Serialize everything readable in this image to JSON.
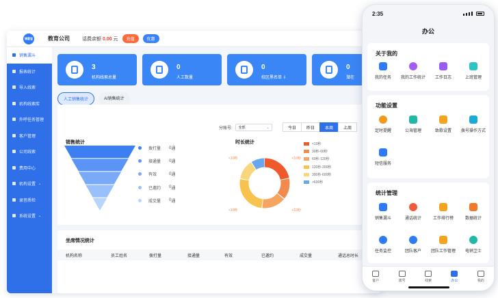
{
  "desktop": {
    "company": "教育公司",
    "balance_label": "话费余额",
    "balance_value": "0.00",
    "balance_unit": "元",
    "recharge": "充值",
    "discount": "优惠",
    "logo_text": "销客宝",
    "sidebar": [
      {
        "label": "销售漏斗",
        "active": true
      },
      {
        "label": "报表统计"
      },
      {
        "label": "导入线索"
      },
      {
        "label": "机构线索库"
      },
      {
        "label": "外呼任务管理"
      },
      {
        "label": "客户管理"
      },
      {
        "label": "公司线索"
      },
      {
        "label": "费用中心"
      },
      {
        "label": "机构设置",
        "arrow": "⌄"
      },
      {
        "label": "录音质检"
      },
      {
        "label": "系统设置",
        "arrow": "⌄"
      }
    ],
    "stats": [
      {
        "value": "3",
        "label": "机构线索总量"
      },
      {
        "value": "0",
        "label": "人工数量"
      },
      {
        "value": "0",
        "label": "校区黑名单 ⇩"
      },
      {
        "value": "0",
        "label": "潜在"
      }
    ],
    "tabs": [
      "人工销售统计",
      "AI销售统计"
    ],
    "filter_label": "分账号:",
    "filter_value": "全部",
    "range_buttons": [
      "今日",
      "昨日",
      "本周",
      "上周"
    ],
    "range_active": 2,
    "sales_title": "销售统计",
    "duration_title": "时长统计",
    "table_title": "坐席情况统计",
    "table_headers": [
      "机构名称",
      "员工姓名",
      "拨打量",
      "接通量",
      "有效",
      "已邀约",
      "成交量",
      "通话总时长"
    ]
  },
  "chart_data": [
    {
      "type": "funnel",
      "title": "销售统计",
      "categories": [
        "拨打量",
        "接通量",
        "有效",
        "已邀约",
        "成交量"
      ],
      "values": [
        0,
        0,
        0,
        0,
        0
      ],
      "value_unit": "通",
      "colors": [
        "#3b7ff2",
        "#5a95f5",
        "#78aaf7",
        "#98c0fa",
        "#b8d4fc"
      ]
    },
    {
      "type": "pie",
      "title": "时长统计",
      "categories": [
        "<10秒",
        "30秒-60秒",
        "60秒-120秒",
        "120秒-200秒",
        "300秒-600秒",
        ">600秒"
      ],
      "values": [
        22,
        14,
        16,
        26,
        13,
        9
      ],
      "colors": [
        "#ee5a2c",
        "#f08a4d",
        "#f6a561",
        "#f7c24d",
        "#f9d67c",
        "#6aa5f0"
      ],
      "outer_labels": [
        "<10秒",
        "<10秒",
        "<10秒",
        "<10秒"
      ]
    }
  ],
  "phone": {
    "time": "2:35",
    "title": "办公",
    "sections": [
      {
        "title": "关于我的",
        "items": [
          {
            "label": "我的任务",
            "color": "#2f7bf5"
          },
          {
            "label": "我的工作统计",
            "color": "#a35df5"
          },
          {
            "label": "工作日志",
            "color": "#9a5cf0"
          },
          {
            "label": "上班管理",
            "color": "#2ec4c7"
          }
        ]
      },
      {
        "title": "功能设置",
        "items": [
          {
            "label": "定时提醒",
            "color": "#f29a1c"
          },
          {
            "label": "公海管理",
            "color": "#21b8a6"
          },
          {
            "label": "致歌设置",
            "color": "#f2a51c"
          },
          {
            "label": "拨号操作方式",
            "color": "#1aa9d9"
          },
          {
            "label": "短信服务",
            "color": "#2f7bf5"
          }
        ]
      },
      {
        "title": "统计管理",
        "items": [
          {
            "label": "销售漏斗",
            "color": "#2f7bf5"
          },
          {
            "label": "通话统计",
            "color": "#f25a3c"
          },
          {
            "label": "工作排行榜",
            "color": "#f2a51c"
          },
          {
            "label": "数据统计",
            "color": "#f07a2c"
          },
          {
            "label": "任务监控",
            "color": "#2f7bf5"
          },
          {
            "label": "团队客户",
            "color": "#2f7bf5"
          },
          {
            "label": "团队工作管理",
            "color": "#f2a51c"
          },
          {
            "label": "电销卫士",
            "color": "#21b8a6"
          }
        ]
      }
    ],
    "tabbar": [
      {
        "label": "客户"
      },
      {
        "label": "拨号"
      },
      {
        "label": "线索"
      },
      {
        "label": "办公",
        "active": true
      },
      {
        "label": "我的"
      }
    ]
  }
}
